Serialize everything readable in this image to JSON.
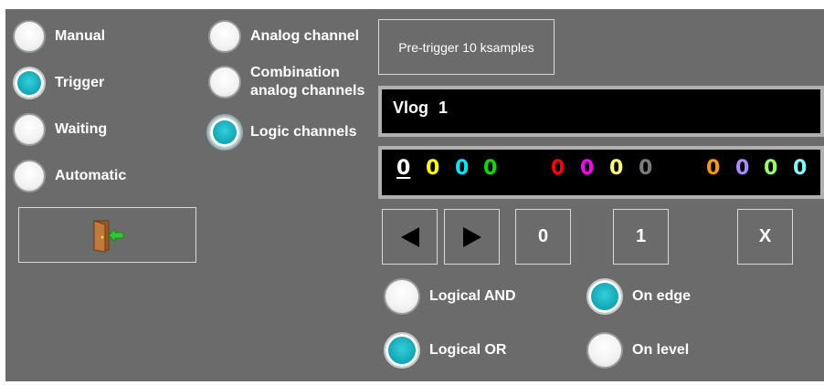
{
  "mode_options": [
    {
      "label": "Manual",
      "selected": false
    },
    {
      "label": "Trigger",
      "selected": true
    },
    {
      "label": "Waiting",
      "selected": false
    },
    {
      "label": "Automatic",
      "selected": false
    }
  ],
  "channel_options": [
    {
      "label": "Analog channel",
      "selected": false
    },
    {
      "label": "Combination analog channels",
      "selected": false
    },
    {
      "label": "Logic channels",
      "selected": true
    }
  ],
  "exit_button": {
    "icon": "exit-door-icon"
  },
  "pretrigger_button": {
    "label": "Pre-trigger 10 ksamples"
  },
  "channel_display": {
    "text": "Vlog  1"
  },
  "bits": [
    {
      "value": "0",
      "color": "#ffffff"
    },
    {
      "value": "0",
      "color": "#ffff00"
    },
    {
      "value": "0",
      "color": "#00e5ff"
    },
    {
      "value": "0",
      "color": "#00e000"
    },
    {
      "value": "0",
      "color": "#ff0000"
    },
    {
      "value": "0",
      "color": "#ff00ff"
    },
    {
      "value": "0",
      "color": "#ffff66"
    },
    {
      "value": "0",
      "color": "#7a7a7a"
    },
    {
      "value": "0",
      "color": "#ff9900"
    },
    {
      "value": "0",
      "color": "#a98cff"
    },
    {
      "value": "0",
      "color": "#99ff66"
    },
    {
      "value": "0",
      "color": "#7fffff"
    }
  ],
  "bit_buttons": {
    "left_icon": "left-arrow-icon",
    "right_icon": "right-arrow-icon",
    "zero": "0",
    "one": "1",
    "x": "X"
  },
  "logic_options": [
    {
      "label": "Logical AND",
      "selected": false
    },
    {
      "label": "Logical OR",
      "selected": true
    }
  ],
  "edge_options": [
    {
      "label": "On edge",
      "selected": true
    },
    {
      "label": "On level",
      "selected": false
    }
  ],
  "colors": {
    "panel": "#6b6b6b",
    "accent": "#0fa2b2"
  }
}
